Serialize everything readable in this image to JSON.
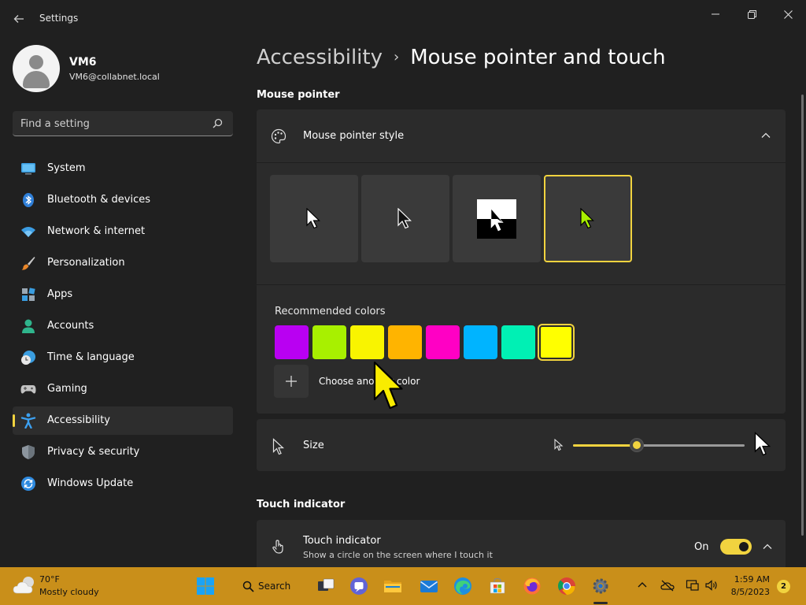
{
  "window": {
    "title": "Settings",
    "controls": [
      "minimize",
      "maximize",
      "close"
    ]
  },
  "profile": {
    "name": "VM6",
    "email": "VM6@collabnet.local"
  },
  "search": {
    "placeholder": "Find a setting"
  },
  "nav": {
    "items": [
      {
        "label": "System",
        "icon": "monitor-icon"
      },
      {
        "label": "Bluetooth & devices",
        "icon": "bluetooth-icon"
      },
      {
        "label": "Network & internet",
        "icon": "wifi-icon"
      },
      {
        "label": "Personalization",
        "icon": "brush-icon"
      },
      {
        "label": "Apps",
        "icon": "apps-icon"
      },
      {
        "label": "Accounts",
        "icon": "person-icon"
      },
      {
        "label": "Time & language",
        "icon": "globe-clock-icon"
      },
      {
        "label": "Gaming",
        "icon": "gamepad-icon"
      },
      {
        "label": "Accessibility",
        "icon": "accessibility-icon"
      },
      {
        "label": "Privacy & security",
        "icon": "shield-icon"
      },
      {
        "label": "Windows Update",
        "icon": "update-icon"
      }
    ],
    "active": "Accessibility"
  },
  "breadcrumb": {
    "parent": "Accessibility",
    "separator": "›",
    "current": "Mouse pointer and touch"
  },
  "mouse_pointer": {
    "section_title": "Mouse pointer",
    "style_card": {
      "label": "Mouse pointer style",
      "styles": [
        "white",
        "black",
        "inverted",
        "custom"
      ],
      "selected_style": "custom",
      "recommended_label": "Recommended colors",
      "colors": [
        "#b900f2",
        "#a8f000",
        "#f9f400",
        "#ffb400",
        "#ff00c4",
        "#00b4ff",
        "#00f0b4",
        "#ffff00"
      ],
      "selected_color": "#ffff00",
      "choose_color_label": "Choose another color"
    },
    "size": {
      "label": "Size",
      "value_fraction": 0.37
    }
  },
  "touch": {
    "section_title": "Touch indicator",
    "title": "Touch indicator",
    "description": "Show a circle on the screen where I touch it",
    "state_label": "On"
  },
  "taskbar": {
    "weather_temp": "70°F",
    "weather_desc": "Mostly cloudy",
    "search_label": "Search",
    "time": "1:59 AM",
    "date": "8/5/2023",
    "notification_count": "2"
  },
  "colors": {
    "accent": "#f1d33f",
    "background": "#202020",
    "card": "#2b2b2b",
    "taskbar": "#c98f1a"
  }
}
